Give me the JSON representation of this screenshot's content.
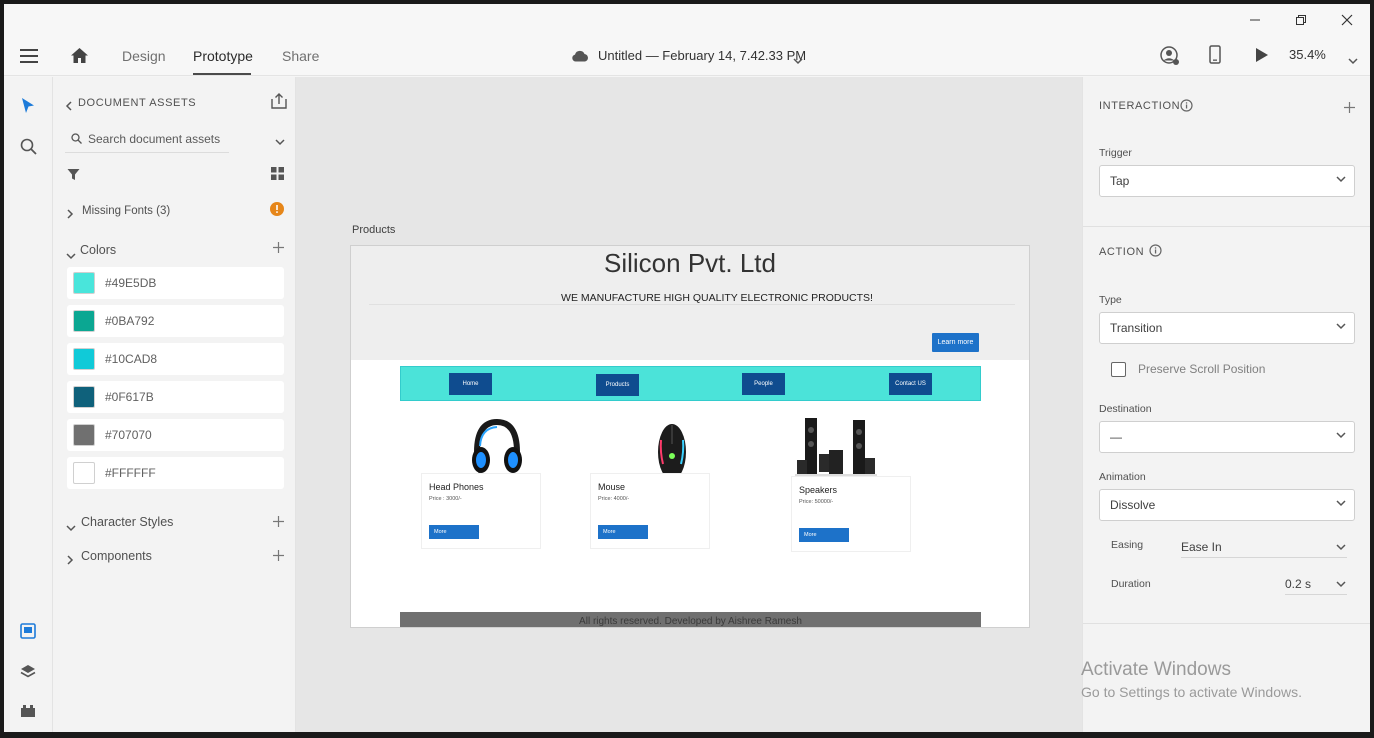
{
  "titlebar": {
    "minimize": "minimize",
    "maximize": "maximize",
    "close": "close"
  },
  "appbar": {
    "tabs": [
      "Design",
      "Prototype",
      "Share"
    ],
    "active_tab": "Prototype",
    "doc_title": "Untitled — February 14, 7.42.33 PM",
    "zoom": "35.4%"
  },
  "assets": {
    "header": "DOCUMENT ASSETS",
    "search_placeholder": "Search document assets",
    "missing_fonts": "Missing Fonts (3)",
    "colors_title": "Colors",
    "colors": [
      {
        "label": "#49E5DB",
        "hex": "#49E5DB"
      },
      {
        "label": "#0BA792",
        "hex": "#0BA792"
      },
      {
        "label": "#10CAD8",
        "hex": "#10CAD8"
      },
      {
        "label": "#0F617B",
        "hex": "#0F617B"
      },
      {
        "label": "#707070",
        "hex": "#707070"
      },
      {
        "label": "#FFFFFF",
        "hex": "#FFFFFF"
      }
    ],
    "character_styles": "Character Styles",
    "components": "Components"
  },
  "canvas": {
    "artboard_label": "Products",
    "site": {
      "title": "Silicon Pvt. Ltd",
      "subtitle": "WE MANUFACTURE HIGH QUALITY ELECTRONIC PRODUCTS!",
      "learn_more": "Learn more",
      "nav": [
        "Home",
        "Products",
        "People",
        "Contact US"
      ],
      "products": [
        {
          "name": "Head Phones",
          "price": "Price : 3000/-",
          "more": "More"
        },
        {
          "name": "Mouse",
          "price": "Price: 4000/-",
          "more": "More"
        },
        {
          "name": "Speakers",
          "price": "Price: 50000/-",
          "more": "More"
        }
      ],
      "footer": "All rights reserved. Developed by Aishree Ramesh"
    }
  },
  "props": {
    "interaction_title": "INTERACTION",
    "trigger_label": "Trigger",
    "trigger_value": "Tap",
    "action_title": "ACTION",
    "type_label": "Type",
    "type_value": "Transition",
    "preserve_scroll": "Preserve Scroll Position",
    "destination_label": "Destination",
    "destination_value": "—",
    "animation_label": "Animation",
    "animation_value": "Dissolve",
    "easing_label": "Easing",
    "easing_value": "Ease In",
    "duration_label": "Duration",
    "duration_value": "0.2 s"
  },
  "watermark": {
    "line1": "Activate Windows",
    "line2": "Go to Settings to activate Windows."
  },
  "accent": "#1d72c9"
}
